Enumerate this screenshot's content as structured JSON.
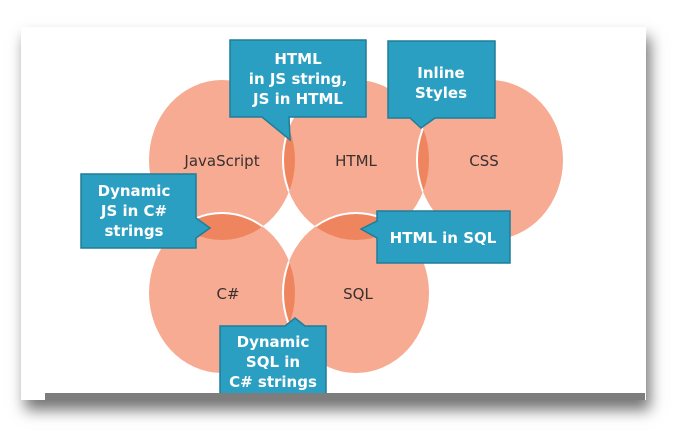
{
  "circles": {
    "javascript": "JavaScript",
    "html": "HTML",
    "css": "CSS",
    "csharp": "C#",
    "sql": "SQL"
  },
  "callouts": {
    "js_html": [
      "HTML",
      "in JS string,",
      "JS in HTML"
    ],
    "html_css": [
      "Inline",
      "Styles"
    ],
    "js_csharp": [
      "Dynamic",
      "JS in C#",
      "strings"
    ],
    "html_sql": [
      "HTML in SQL"
    ],
    "csharp_sql": [
      "Dynamic",
      "SQL in",
      "C# strings"
    ]
  },
  "colors": {
    "circle": "#f6ab92",
    "overlap": "#ef855f",
    "callout": "#2b9fc1",
    "callout_border": "#1f7d98"
  }
}
